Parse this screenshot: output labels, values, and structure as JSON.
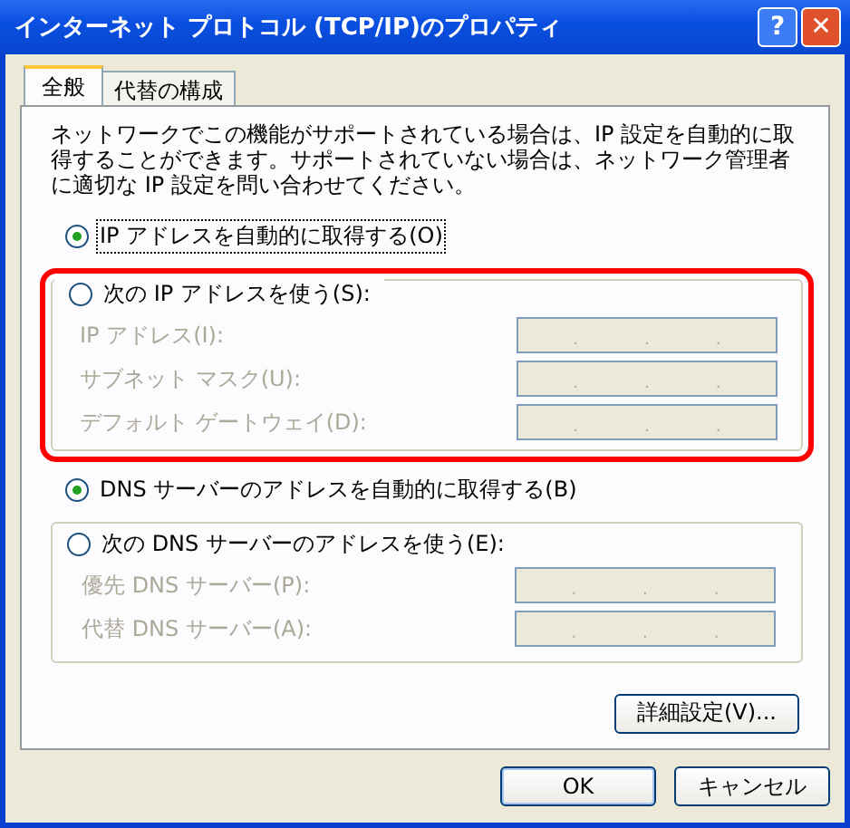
{
  "window": {
    "title": "インターネット プロトコル (TCP/IP)のプロパティ",
    "help": "?",
    "close": "✕"
  },
  "tabs": [
    {
      "label": "全般",
      "selected": true
    },
    {
      "label": "代替の構成",
      "selected": false
    }
  ],
  "description": "ネットワークでこの機能がサポートされている場合は、IP 設定を自動的に取得することができます。サポートされていない場合は、ネットワーク管理者に適切な IP 設定を問い合わせてください。",
  "sections": [
    {
      "auto_option": {
        "label": "IP アドレスを自動的に取得する(O)",
        "selected": true,
        "focused": true
      },
      "manual_option": {
        "label": "次の IP アドレスを使う(S):",
        "selected": false
      },
      "highlight": true,
      "fields": [
        {
          "label": "IP アドレス(I):",
          "dots": [
            ".",
            ".",
            "."
          ],
          "disabled": true
        },
        {
          "label": "サブネット マスク(U):",
          "dots": [
            ".",
            ".",
            "."
          ],
          "disabled": true
        },
        {
          "label": "デフォルト ゲートウェイ(D):",
          "dots": [
            ".",
            ".",
            "."
          ],
          "disabled": true
        }
      ]
    },
    {
      "auto_option": {
        "label": "DNS サーバーのアドレスを自動的に取得する(B)",
        "selected": true,
        "focused": false
      },
      "manual_option": {
        "label": "次の DNS サーバーのアドレスを使う(E):",
        "selected": false
      },
      "highlight": false,
      "fields": [
        {
          "label": "優先 DNS サーバー(P):",
          "dots": [
            ".",
            ".",
            "."
          ],
          "disabled": true
        },
        {
          "label": "代替 DNS サーバー(A):",
          "dots": [
            ".",
            ".",
            "."
          ],
          "disabled": true
        }
      ]
    }
  ],
  "advanced_button": "詳細設定(V)...",
  "buttons": [
    {
      "label": "OK",
      "default": true
    },
    {
      "label": "キャンセル",
      "default": false
    }
  ]
}
